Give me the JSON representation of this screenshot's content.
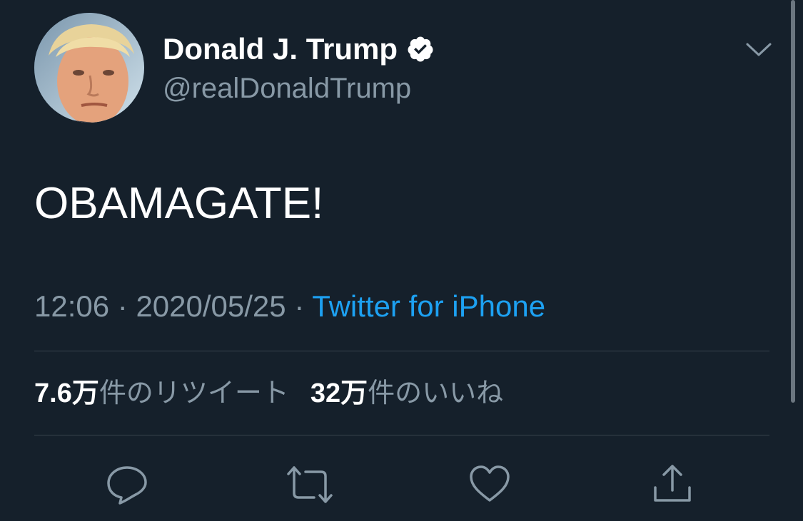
{
  "colors": {
    "background": "#15202b",
    "primary_text": "#ffffff",
    "secondary_text": "#8899a6",
    "link": "#1da1f2",
    "divider": "#38444d"
  },
  "author": {
    "display_name": "Donald J. Trump",
    "handle": "@realDonaldTrump",
    "verified": true,
    "avatar_icon": "profile-photo"
  },
  "tweet": {
    "text": "OBAMAGATE!",
    "time": "12:06",
    "separator": "·",
    "date": "2020/05/25",
    "source": "Twitter for iPhone"
  },
  "stats": {
    "retweets_count": "7.6万",
    "retweets_label": "件のリツイート",
    "likes_count": "32万",
    "likes_label": "件のいいね"
  },
  "actions": [
    {
      "icon": "reply-icon"
    },
    {
      "icon": "retweet-icon"
    },
    {
      "icon": "like-icon"
    },
    {
      "icon": "share-icon"
    }
  ]
}
